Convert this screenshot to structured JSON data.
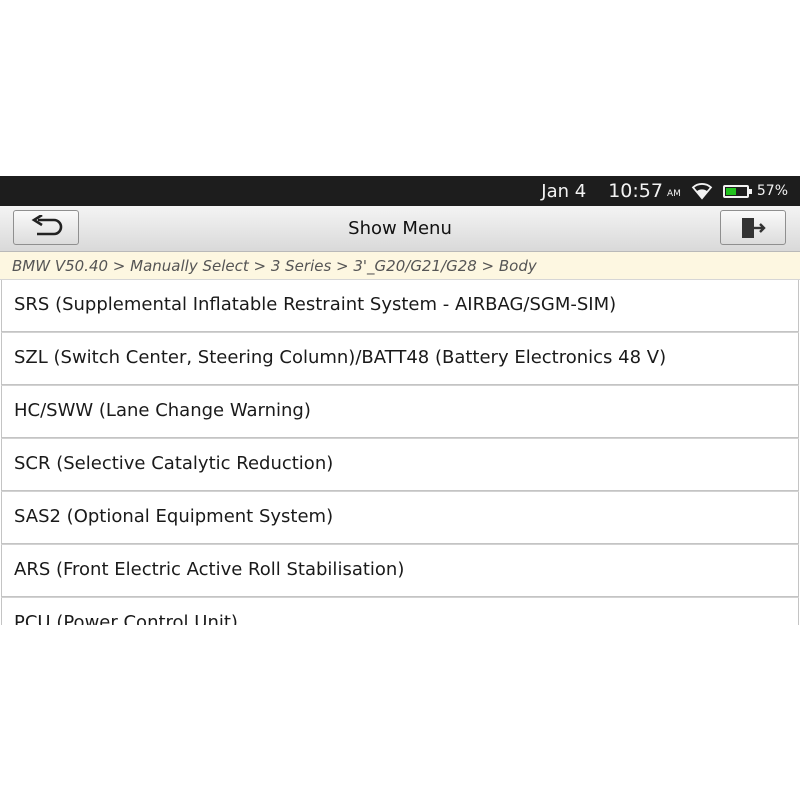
{
  "status_bar": {
    "date": "Jan 4",
    "time": "10:57",
    "ampm": "AM",
    "battery_percent": "57%",
    "battery_level": 0.57,
    "battery_color": "#22c21e"
  },
  "header": {
    "title": "Show Menu",
    "back_icon": "back-arrow-icon",
    "exit_icon": "exit-door-icon"
  },
  "breadcrumb": "BMW V50.40 > Manually Select > 3 Series > 3'_G20/G21/G28 > Body",
  "menu": {
    "items": [
      "SRS (Supplemental Inflatable Restraint System - AIRBAG/SGM-SIM)",
      "SZL (Switch Center, Steering Column)/BATT48 (Battery Electronics 48 V)",
      "HC/SWW (Lane Change Warning)",
      "SCR (Selective Catalytic Reduction)",
      "SAS2 (Optional Equipment System)",
      "ARS (Front Electric Active Roll Stabilisation)",
      "PCU (Power Control Unit)"
    ]
  }
}
